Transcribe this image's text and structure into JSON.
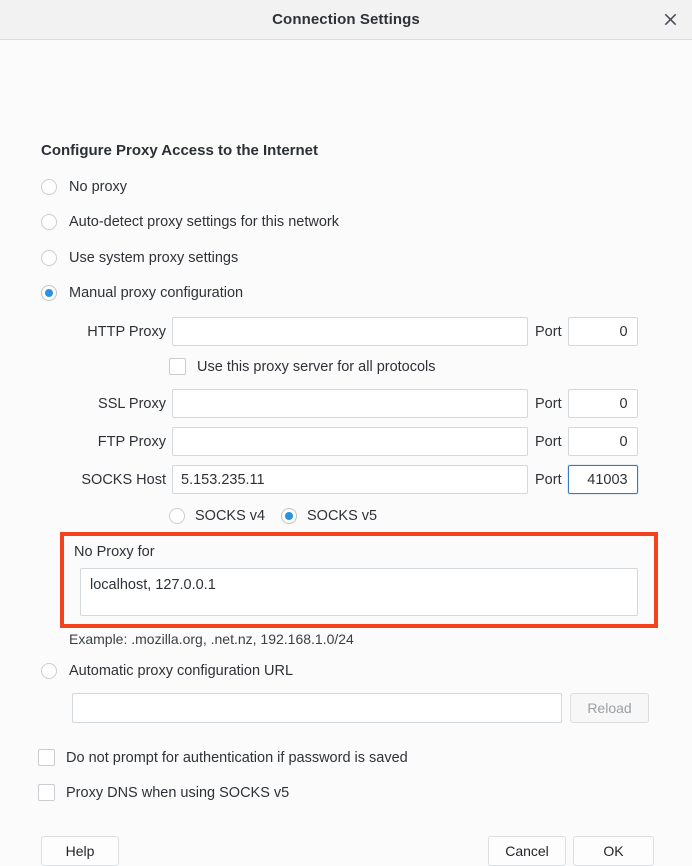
{
  "window": {
    "title": "Connection Settings",
    "close_icon": "close-icon"
  },
  "main": {
    "heading": "Configure Proxy Access to the Internet",
    "proxy_mode_options": [
      {
        "label": "No proxy",
        "selected": false
      },
      {
        "label": "Auto-detect proxy settings for this network",
        "selected": false
      },
      {
        "label": "Use system proxy settings",
        "selected": false
      },
      {
        "label": "Manual proxy configuration",
        "selected": true
      },
      {
        "label": "Automatic proxy configuration URL",
        "selected": false
      }
    ],
    "manual": {
      "http": {
        "label": "HTTP Proxy",
        "value": "",
        "port_label": "Port",
        "port_value": "0"
      },
      "use_for_all": {
        "label": "Use this proxy server for all protocols",
        "checked": false
      },
      "ssl": {
        "label": "SSL Proxy",
        "value": "",
        "port_label": "Port",
        "port_value": "0"
      },
      "ftp": {
        "label": "FTP Proxy",
        "value": "",
        "port_label": "Port",
        "port_value": "0"
      },
      "socks": {
        "label": "SOCKS Host",
        "value": "5.153.235.11",
        "port_label": "Port",
        "port_value": "41003"
      },
      "socks_versions": [
        {
          "label": "SOCKS v4",
          "selected": false
        },
        {
          "label": "SOCKS v5",
          "selected": true
        }
      ]
    },
    "no_proxy": {
      "label": "No Proxy for",
      "value": "localhost, 127.0.0.1",
      "example": "Example: .mozilla.org, .net.nz, 192.168.1.0/24",
      "highlight_color": "#f4411e"
    },
    "pac": {
      "url_value": "",
      "reload_label": "Reload"
    },
    "options": [
      {
        "label": "Do not prompt for authentication if password is saved",
        "checked": false
      },
      {
        "label": "Proxy DNS when using SOCKS v5",
        "checked": false
      }
    ]
  },
  "footer": {
    "help_label": "Help",
    "cancel_label": "Cancel",
    "ok_label": "OK"
  },
  "theme": {
    "accent": "#2a92e0",
    "focus_border": "#3b78c2",
    "highlight": "#f4411e"
  }
}
